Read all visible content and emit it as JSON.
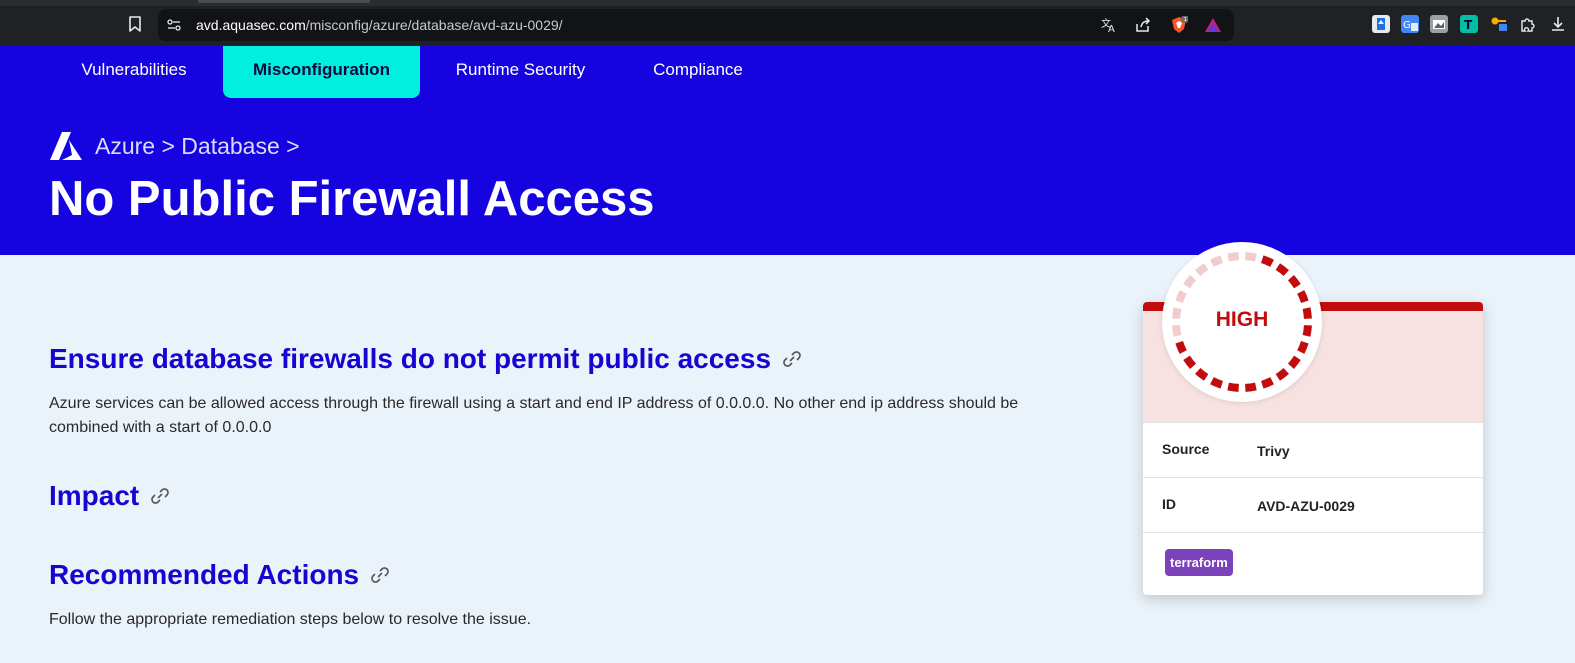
{
  "browser": {
    "url_host": "avd.aquasec.com",
    "url_path": "/misconfig/azure/database/avd-azu-0029/",
    "icons": [
      "bookmark-icon",
      "site-info-icon",
      "translate-icon",
      "share-icon",
      "brave-shields-icon",
      "brave-rewards-icon",
      "extension-icons",
      "puzzle-icon",
      "download-icon"
    ],
    "shields_count": "1"
  },
  "nav": {
    "items": [
      {
        "label": "Vulnerabilities"
      },
      {
        "label": "Misconfiguration",
        "active": true
      },
      {
        "label": "Runtime Security"
      },
      {
        "label": "Compliance"
      }
    ]
  },
  "hero": {
    "breadcrumb": "Azure > Database >",
    "title": "No Public Firewall Access"
  },
  "content": {
    "heading1": "Ensure database firewalls do not permit public access",
    "description": "Azure services can be allowed access through the firewall using a start and end IP address of 0.0.0.0. No other end ip address should be combined with a start of 0.0.0.0",
    "heading2": "Impact",
    "heading3": "Recommended Actions",
    "recommended_text": "Follow the appropriate remediation steps below to resolve the issue."
  },
  "card": {
    "severity": "HIGH",
    "severity_color": "#c10d0d",
    "source_label": "Source",
    "source_value": "Trivy",
    "id_label": "ID",
    "id_value": "AVD-AZU-0029",
    "tag": "terraform"
  },
  "colors": {
    "brand": "#1604e0",
    "active_tab": "#00f0e0",
    "heading": "#1604d0"
  }
}
